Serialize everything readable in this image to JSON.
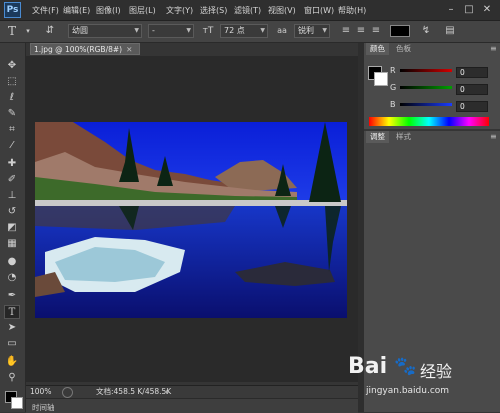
{
  "menubar": {
    "logo": "Ps",
    "items": [
      "文件(F)",
      "编辑(E)",
      "图像(I)",
      "图层(L)",
      "文字(Y)",
      "选择(S)",
      "滤镜(T)",
      "视图(V)",
      "窗口(W)",
      "帮助(H)"
    ],
    "window_controls": [
      "–",
      "□",
      "✕"
    ]
  },
  "options_bar": {
    "tool_glyph": "T",
    "font_family": "幼圆",
    "font_style": "-",
    "font_size": "72 点",
    "antialias": "锐利"
  },
  "document": {
    "tab_title": "1.jpg @ 100%(RGB/8#)",
    "zoom": "100%",
    "file_info": "文档:458.5 K/458.5K"
  },
  "color_panel": {
    "tabs": [
      "颜色",
      "色板"
    ],
    "channels": [
      {
        "label": "R",
        "value": "0",
        "color": "#d40000"
      },
      {
        "label": "G",
        "value": "0",
        "color": "#00a000"
      },
      {
        "label": "B",
        "value": "0",
        "color": "#1a3cff"
      }
    ]
  },
  "adjustments_panel": {
    "tabs": [
      "调整",
      "样式"
    ]
  },
  "bottom_panel": {
    "label": "时间轴"
  },
  "watermark": {
    "brand": "Bai",
    "brand_suffix": "经验",
    "url": "jingyan.baidu.com"
  },
  "tools": [
    "move-tool",
    "marquee-tool",
    "lasso-tool",
    "quick-select-tool",
    "crop-tool",
    "eyedropper-tool",
    "healing-brush-tool",
    "brush-tool",
    "clone-stamp-tool",
    "history-brush-tool",
    "eraser-tool",
    "gradient-tool",
    "blur-tool",
    "dodge-tool",
    "pen-tool",
    "type-tool",
    "path-select-tool",
    "shape-tool",
    "hand-tool",
    "zoom-tool"
  ]
}
